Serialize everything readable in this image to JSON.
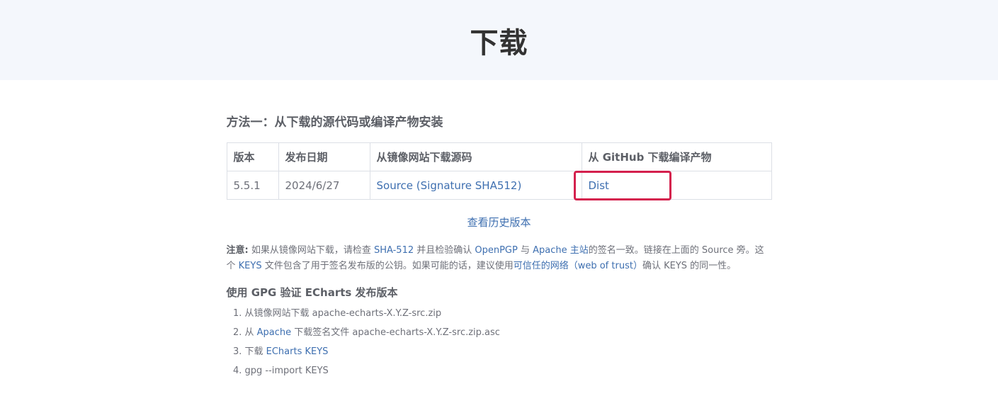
{
  "hero": {
    "title": "下载"
  },
  "method1": {
    "title": "方法一：从下载的源代码或编译产物安装"
  },
  "table": {
    "headers": [
      "版本",
      "发布日期",
      "从镜像网站下载源码",
      "从 GitHub 下载编译产物"
    ],
    "row": {
      "version": "5.5.1",
      "date": "2024/6/27",
      "source": "Source (Signature SHA512)",
      "dist": "Dist"
    }
  },
  "history_link": "查看历史版本",
  "note": {
    "label": "注意:",
    "t1": " 如果从镜像网站下载，请检查 ",
    "l1": "SHA-512",
    "t2": " 并且检验确认 ",
    "l2": "OpenPGP",
    "t3": " 与 ",
    "l3": "Apache 主站",
    "t4": "的签名一致。链接在上面的 Source 旁。这个 ",
    "l4": "KEYS",
    "t5": " 文件包含了用于签名发布版的公钥。如果可能的话，建议使用",
    "l5": "可信任的网络（web of trust）",
    "t6": "确认 KEYS 的同一性。"
  },
  "gpg": {
    "title": "使用 GPG 验证 ECharts 发布版本",
    "step1": "从镜像网站下载 apache-echarts-X.Y.Z-src.zip",
    "step2_pre": "从 ",
    "step2_link": "Apache",
    "step2_post": " 下载签名文件 apache-echarts-X.Y.Z-src.zip.asc",
    "step3_pre": "下载 ",
    "step3_link": "ECharts KEYS",
    "step4": "gpg --import KEYS"
  },
  "colors": {
    "link": "#3e6fb0",
    "highlight": "#d4204d",
    "hero_bg": "#f4f7fc"
  }
}
